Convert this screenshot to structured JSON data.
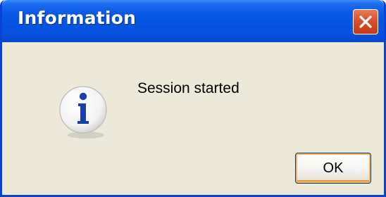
{
  "dialog": {
    "title": "Information",
    "message": "Session started",
    "icon": "information-icon",
    "ok_label": "OK"
  },
  "titlebar": {
    "close_icon": "close-icon"
  },
  "colors": {
    "titlebar": "#0553df",
    "body": "#ece9d8",
    "close_button": "#d9512c",
    "button_focus": "#f6b66a"
  }
}
